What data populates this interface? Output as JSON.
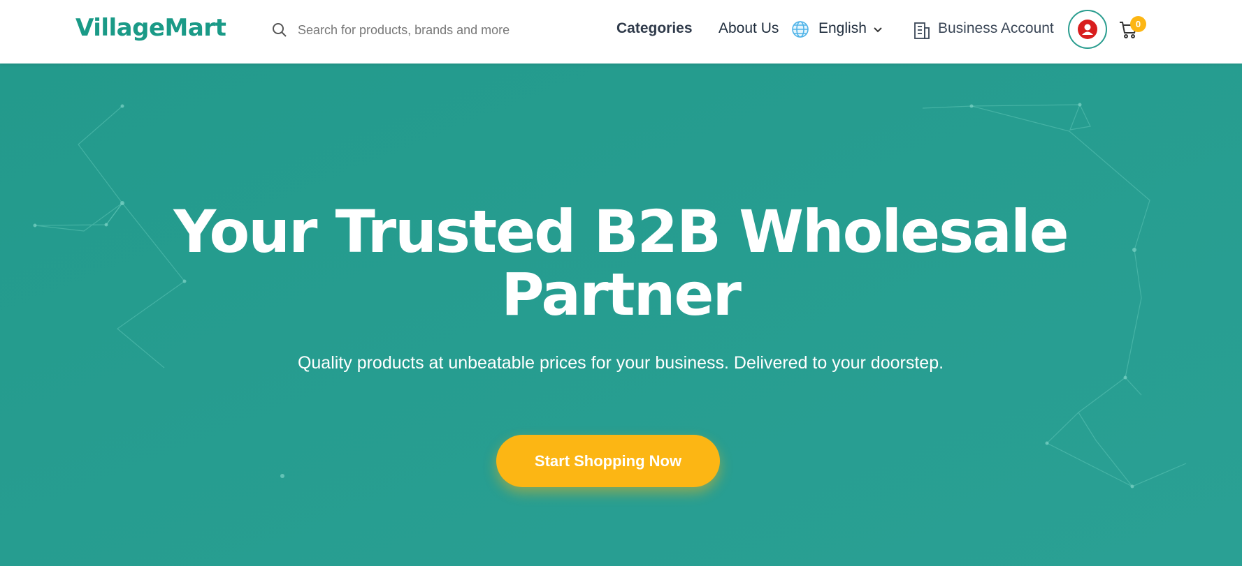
{
  "header": {
    "logo": "VillageMart",
    "search": {
      "placeholder": "Search for products, brands and more",
      "value": ""
    },
    "nav": {
      "categories": "Categories",
      "about": "About Us",
      "language": "English",
      "business_account": "Business Account"
    },
    "cart_count": "0"
  },
  "hero": {
    "title": "Your Trusted B2B Wholesale Partner",
    "subtitle": "Quality products at unbeatable prices for your business. Delivered to your doorstep.",
    "cta_label": "Start Shopping Now"
  },
  "colors": {
    "brand": "#1a9a87",
    "hero_bg": "#2a9d8f",
    "cta": "#fcb614",
    "avatar": "#d81e1e",
    "badge": "#fcb614"
  },
  "icons": {
    "search": "search-icon",
    "language": "globe-icon",
    "dropdown": "chevron-down-icon",
    "business": "building-icon",
    "account": "user-avatar-icon",
    "cart": "cart-icon"
  }
}
